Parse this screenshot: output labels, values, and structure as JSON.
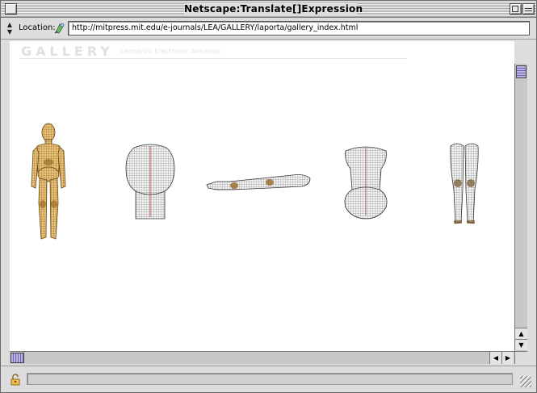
{
  "window": {
    "title": "Netscape:Translate[]Expression"
  },
  "location": {
    "label": "Location:",
    "url": "http://mitpress.mit.edu/e-journals/LEA/GALLERY/laporta/gallery_index.html"
  },
  "page": {
    "logo": "GALLERY",
    "subtitle": "Leonardo Electronic Almanac",
    "figures": [
      {
        "name": "full-body-wireframe",
        "color": "#b07a1c"
      },
      {
        "name": "torso-back-wireframe",
        "color": "#555555"
      },
      {
        "name": "arm-wireframe",
        "color": "#555555"
      },
      {
        "name": "torso-front-wireframe",
        "color": "#555555"
      },
      {
        "name": "legs-wireframe",
        "color": "#555555"
      }
    ]
  },
  "status": {
    "text": ""
  },
  "colors": {
    "chrome": "#dddddd",
    "scroll_thumb": "#b9b3e4",
    "wire_gold": "#b07a1c",
    "wire_gray": "#555555"
  }
}
